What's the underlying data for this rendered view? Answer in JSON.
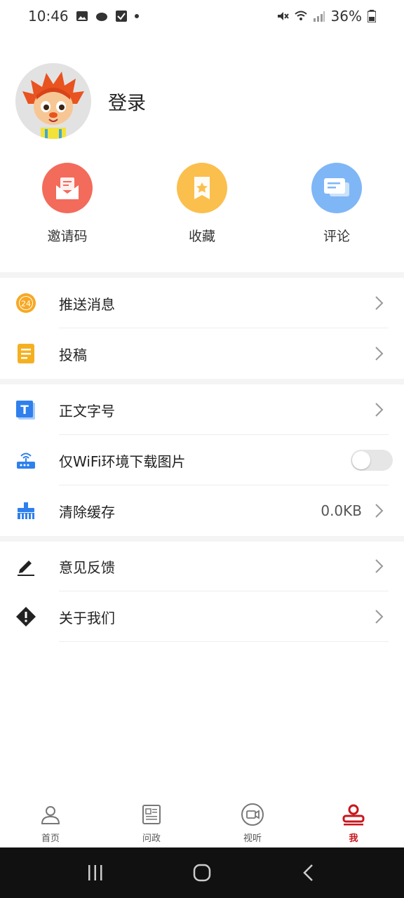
{
  "status_bar": {
    "time": "10:46",
    "battery": "36%"
  },
  "profile": {
    "login_label": "登录"
  },
  "quick_actions": [
    {
      "label": "邀请码",
      "color": "#f36b5b",
      "icon": "invite-mail-icon"
    },
    {
      "label": "收藏",
      "color": "#fbbf4d",
      "icon": "bookmark-star-icon"
    },
    {
      "label": "评论",
      "color": "#7fb6f6",
      "icon": "comment-bubbles-icon"
    }
  ],
  "menu": {
    "push_messages": {
      "label": "推送消息",
      "badge": "24"
    },
    "submit": {
      "label": "投稿"
    },
    "font_size": {
      "label": "正文字号",
      "icon_letter": "T"
    },
    "wifi_images": {
      "label": "仅WiFi环境下载图片",
      "enabled": false
    },
    "clear_cache": {
      "label": "清除缓存",
      "value": "0.0KB"
    },
    "feedback": {
      "label": "意见反馈"
    },
    "about": {
      "label": "关于我们"
    }
  },
  "bottom_nav": [
    {
      "label": "首页",
      "icon": "person-icon",
      "active": false
    },
    {
      "label": "问政",
      "icon": "newspaper-icon",
      "active": false
    },
    {
      "label": "视听",
      "icon": "video-camera-icon",
      "active": false
    },
    {
      "label": "我",
      "icon": "user-profile-icon",
      "active": true
    }
  ],
  "colors": {
    "accent": "#c8161d",
    "divider": "#f4f4f4"
  }
}
